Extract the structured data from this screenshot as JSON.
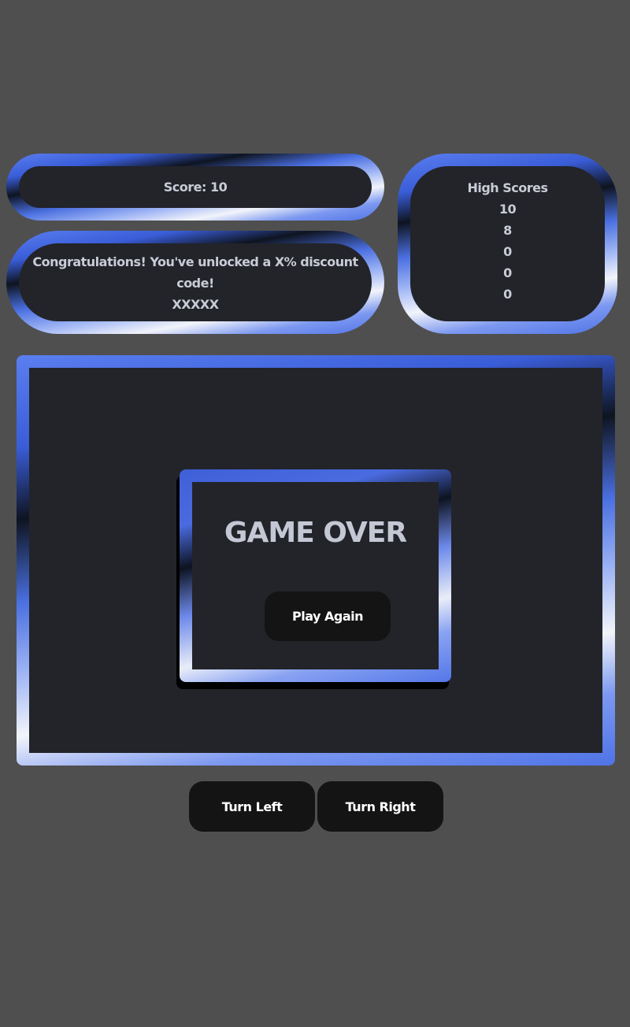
{
  "score": {
    "label": "Score: 10",
    "value": 10
  },
  "promo": {
    "message": "Congratulations! You've unlocked a X% discount code!",
    "code": "XXXXX"
  },
  "high_scores": {
    "title": "High Scores",
    "values": [
      "10",
      "8",
      "0",
      "0",
      "0"
    ]
  },
  "game_over": {
    "title": "GAME OVER",
    "play_again_label": "Play Again"
  },
  "controls": {
    "turn_left_label": "Turn Left",
    "turn_right_label": "Turn Right"
  },
  "colors": {
    "background": "#4f4f4f",
    "panel": "#22242a",
    "accent": "#4f73e6",
    "button": "#141414",
    "text": "#c9ccd6"
  }
}
